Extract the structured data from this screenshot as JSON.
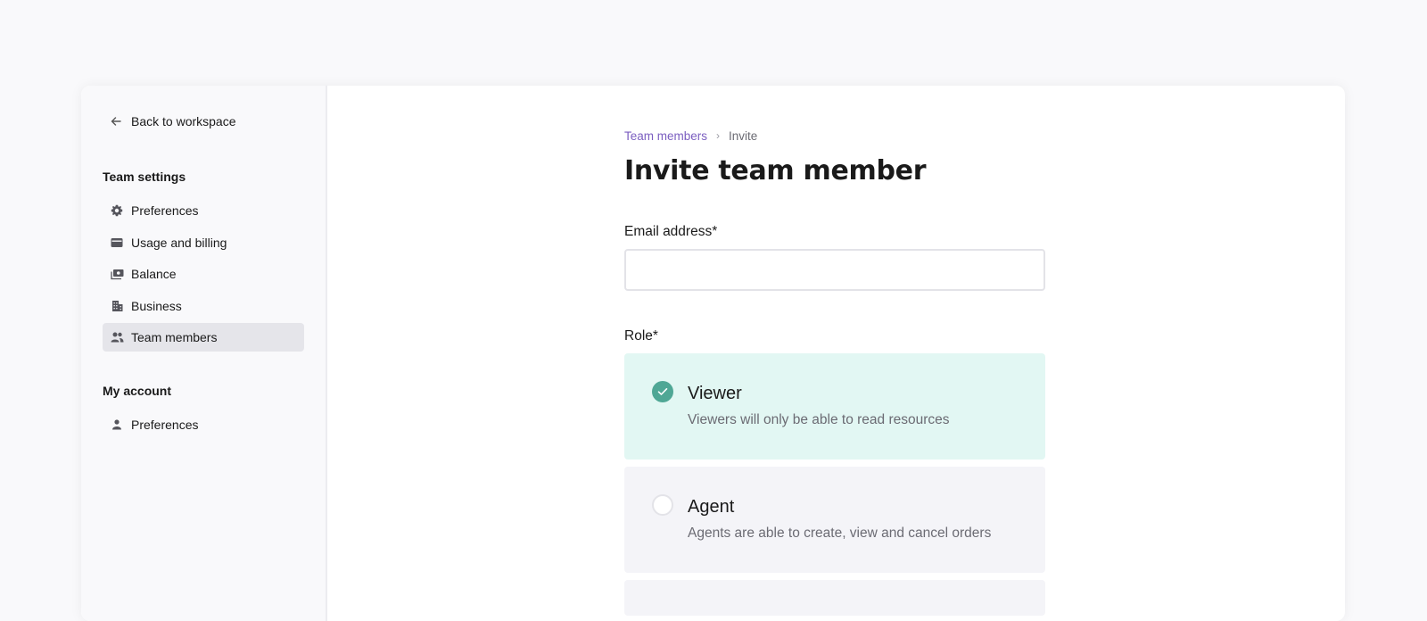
{
  "sidebar": {
    "back_label": "Back to workspace",
    "sections": [
      {
        "title": "Team settings",
        "items": [
          {
            "label": "Preferences",
            "icon": "gear-icon",
            "active": false
          },
          {
            "label": "Usage and billing",
            "icon": "credit-card-icon",
            "active": false
          },
          {
            "label": "Balance",
            "icon": "money-icon",
            "active": false
          },
          {
            "label": "Business",
            "icon": "building-icon",
            "active": false
          },
          {
            "label": "Team members",
            "icon": "people-icon",
            "active": true
          }
        ]
      },
      {
        "title": "My account",
        "items": [
          {
            "label": "Preferences",
            "icon": "person-icon",
            "active": false
          }
        ]
      }
    ]
  },
  "main": {
    "breadcrumb": {
      "parent": "Team members",
      "separator": "›",
      "current": "Invite"
    },
    "title": "Invite team member",
    "email": {
      "label": "Email address*",
      "value": "",
      "placeholder": ""
    },
    "role": {
      "label": "Role*",
      "selected": "Viewer",
      "options": [
        {
          "name": "Viewer",
          "description": "Viewers will only be able to read resources",
          "selected": true
        },
        {
          "name": "Agent",
          "description": "Agents are able to create, view and cancel orders",
          "selected": false
        }
      ]
    }
  },
  "colors": {
    "accent_link": "#7b5ec0",
    "selected_bg": "#e2f7f3",
    "selected_check": "#4fa795",
    "unselected_bg": "#f4f4f8",
    "active_nav_bg": "#e5e5ea"
  }
}
